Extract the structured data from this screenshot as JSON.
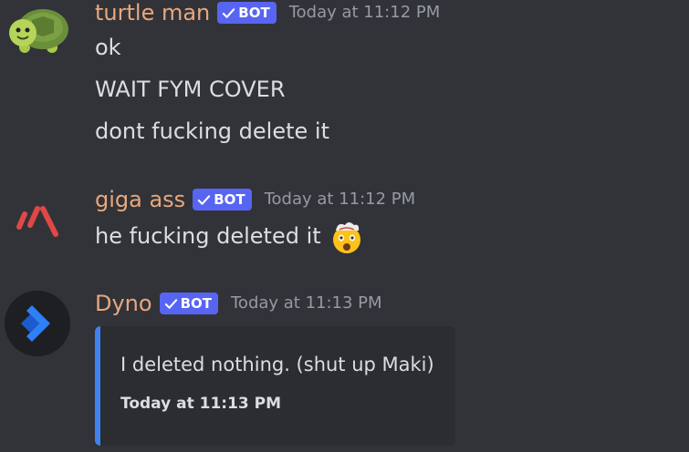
{
  "messages": [
    {
      "username": "turtle man",
      "bot_label": "BOT",
      "timestamp": "Today at 11:12 PM",
      "avatar_icon": "turtle-icon",
      "lines": [
        "ok",
        "WAIT FYM COVER",
        "dont fucking delete it"
      ]
    },
    {
      "username": "giga ass",
      "bot_label": "BOT",
      "timestamp": "Today at 11:12 PM",
      "avatar_icon": "red-slashes-logo-icon",
      "lines": [
        "he fucking deleted it"
      ],
      "emoji": "exploding-head-emoji-icon"
    },
    {
      "username": "Dyno",
      "bot_label": "BOT",
      "timestamp": "Today at 11:13 PM",
      "avatar_icon": "dyno-logo-icon",
      "embed": {
        "description": "I deleted nothing. (shut up Maki)",
        "footer": "Today at 11:13 PM",
        "accent_color": "#3e82f0"
      }
    }
  ],
  "colors": {
    "background": "#313338",
    "username": "#e8a77d",
    "bot_tag": "#5865f2",
    "timestamp": "#949ba4",
    "text": "#dbdee1",
    "embed_bg": "#2b2d31"
  }
}
